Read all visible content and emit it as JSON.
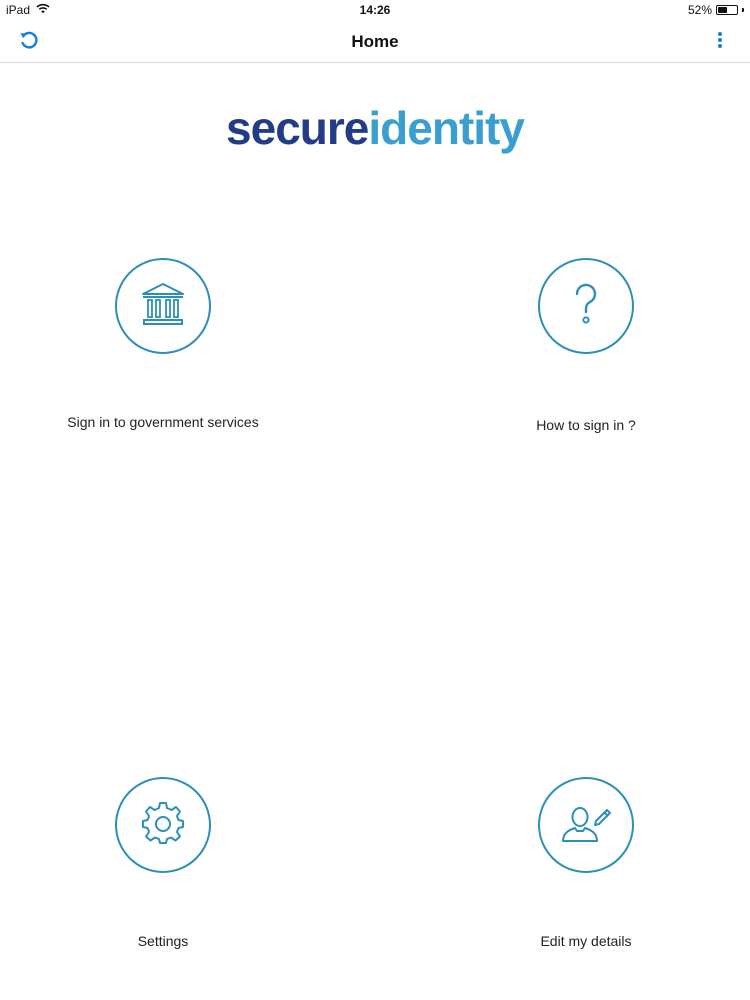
{
  "status_bar": {
    "device": "iPad",
    "time": "14:26",
    "battery": "52%",
    "battery_level": 0.52,
    "wifi_icon": "wifi-icon",
    "battery_icon": "battery-icon"
  },
  "nav": {
    "title": "Home",
    "refresh_icon": "refresh-icon",
    "more_icon": "more-vertical-icon"
  },
  "logo": {
    "part1": "secure",
    "part2": "identity"
  },
  "tiles": [
    {
      "label": "Sign in to government services",
      "icon": "government-building-icon"
    },
    {
      "label": "How to sign in ?",
      "icon": "question-mark-icon"
    },
    {
      "label": "Settings",
      "icon": "gear-icon"
    },
    {
      "label": "Edit my details",
      "icon": "edit-user-icon"
    }
  ],
  "colors": {
    "accent": "#2c8fb8",
    "logo_dark": "#233c86",
    "logo_light": "#3a9fcf",
    "nav_icon": "#1a7fd4"
  }
}
